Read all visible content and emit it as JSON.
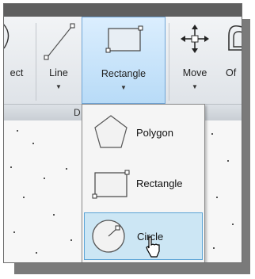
{
  "ribbon": {
    "tools": [
      {
        "label": "ect"
      },
      {
        "label": "Line"
      },
      {
        "label": "Rectangle"
      },
      {
        "label": "Move"
      },
      {
        "label": "Of"
      }
    ],
    "panel_title": "D"
  },
  "dropdown": {
    "items": [
      {
        "label": "Polygon",
        "icon": "polygon-icon",
        "selected": false
      },
      {
        "label": "Rectangle",
        "icon": "rectangle-icon",
        "selected": false
      },
      {
        "label": "Circle",
        "icon": "circle-icon",
        "selected": true
      }
    ]
  },
  "colors": {
    "highlight": "#cce6f4",
    "highlight_border": "#5aa3d6",
    "ribbon_top": "#5f5f5f"
  }
}
